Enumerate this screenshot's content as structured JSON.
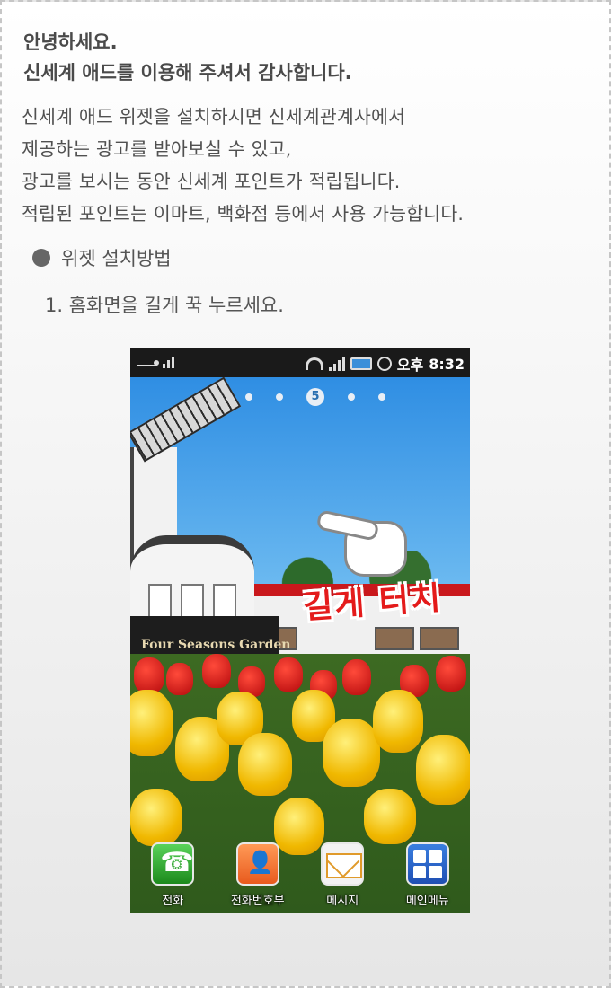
{
  "intro": {
    "greeting": "안녕하세요.",
    "thanks": "신세계 애드를 이용해 주셔서 감사합니다.",
    "description": [
      "신세계 애드 위젯을 설치하시면 신세계관계사에서",
      "제공하는 광고를 받아보실 수 있고,",
      "광고를 보시는 동안 신세계 포인트가 적립됩니다.",
      "적립된 포인트는 이마트, 백화점 등에서 사용 가능합니다."
    ]
  },
  "section": {
    "title": "위젯 설치방법",
    "bullet_icon": "circle-bullet-icon"
  },
  "steps": [
    "1. 홈화면을 길게 꾹 누르세요."
  ],
  "phone": {
    "status": {
      "ampm": "오후",
      "time": "8:32",
      "icons": [
        "usb-icon",
        "signal-icon",
        "wifi-icon",
        "battery-icon",
        "alarm-icon"
      ]
    },
    "home_page_indicator": "5",
    "touch_hint": "길게 터치",
    "signage": "Four Seasons Garden",
    "dock": [
      {
        "label": "전화",
        "icon": "phone-icon"
      },
      {
        "label": "전화번호부",
        "icon": "contacts-icon"
      },
      {
        "label": "메시지",
        "icon": "message-icon"
      },
      {
        "label": "메인메뉴",
        "icon": "main-menu-icon"
      }
    ]
  },
  "colors": {
    "text": "#505050",
    "touch_hint": "#e41b1b",
    "frame_border": "#c6c6c6"
  }
}
